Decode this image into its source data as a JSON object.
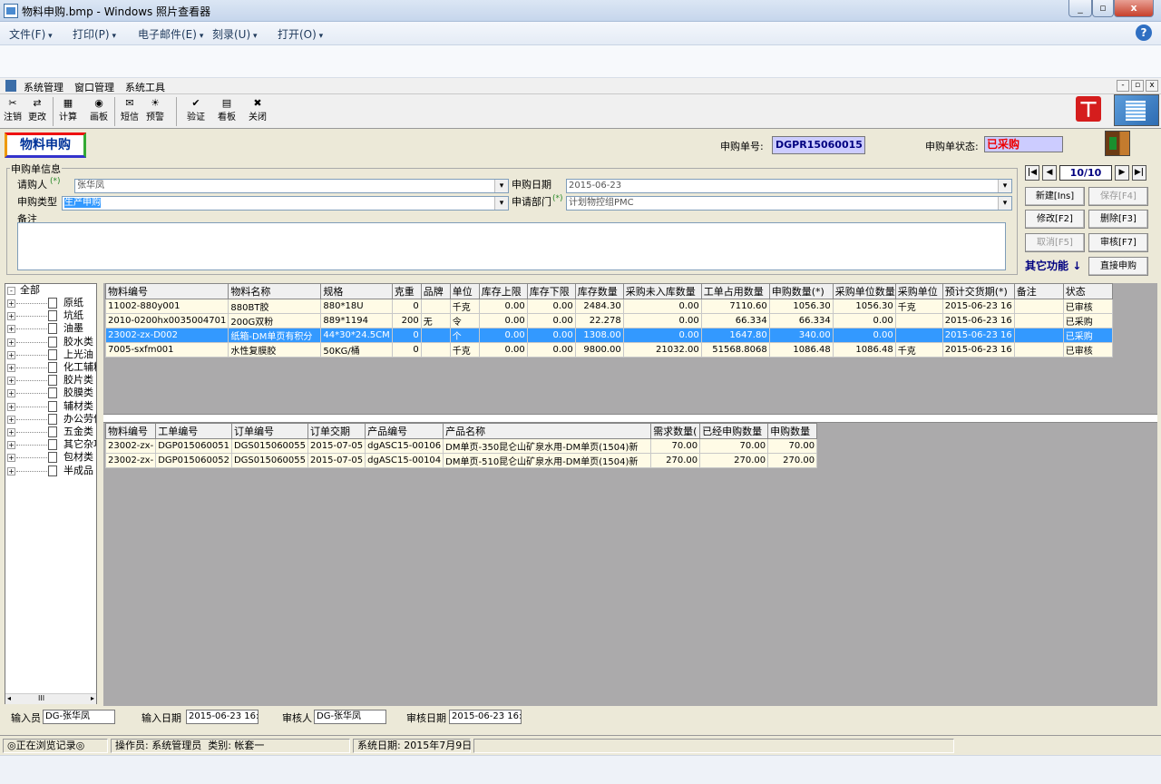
{
  "viewer": {
    "title": "物料申购.bmp - Windows 照片查看器",
    "menu": [
      "文件(F)",
      "打印(P)",
      "电子邮件(E)",
      "刻录(U)",
      "打开(O)"
    ],
    "help": "?"
  },
  "app": {
    "menu": [
      "系统管理",
      "窗口管理",
      "系统工具"
    ],
    "mdi": [
      "-",
      "▫",
      "x"
    ],
    "toolbar": [
      {
        "label": "注销",
        "icon": "logout-icon"
      },
      {
        "label": "更改",
        "icon": "change-icon"
      },
      {
        "label": "计算",
        "icon": "calculator-icon"
      },
      {
        "label": "画板",
        "icon": "palette-icon"
      },
      {
        "label": "短信",
        "icon": "sms-icon"
      },
      {
        "label": "预警",
        "icon": "alert-icon"
      },
      {
        "label": "验证",
        "icon": "verify-icon"
      },
      {
        "label": "看板",
        "icon": "board-icon"
      },
      {
        "label": "关闭",
        "icon": "close-icon"
      }
    ],
    "logo": "ㄒ"
  },
  "header": {
    "page_title": "物料申购",
    "order_no_label": "申购单号:",
    "order_no": "DGPR15060015",
    "status_label": "申购单状态:",
    "status": "已采购"
  },
  "form": {
    "group_label": "申购单信息",
    "requester_label": "请购人",
    "requester": "张华凤",
    "type_label": "申购类型",
    "type": "生产申购",
    "date_label": "申购日期",
    "date": "2015-06-23",
    "dept_label": "申请部门",
    "dept": "计划物控组PMC",
    "remark_label": "备注",
    "required_mark": "(*)"
  },
  "nav": {
    "first": "|◀",
    "prev": "◀",
    "counter": "10/10",
    "next": "▶",
    "last": "▶|"
  },
  "actions": {
    "new": "新建[Ins]",
    "save": "保存[F4]",
    "edit": "修改[F2]",
    "delete": "删除[F3]",
    "cancel": "取消[F5]",
    "approve": "审核[F7]",
    "other": "其它功能",
    "direct": "直接申购"
  },
  "tree": {
    "root": "全部",
    "items": [
      "原纸",
      "坑纸",
      "油墨",
      "胶水类",
      "上光油",
      "化工辅料",
      "胶片类",
      "胶膜类",
      "辅材类",
      "办公劳保",
      "五金类",
      "其它杂项",
      "包材类",
      "半成品"
    ],
    "scroll_mid": "III"
  },
  "grid1": {
    "columns": [
      "物料编号",
      "物料名称",
      "规格",
      "克重",
      "品牌",
      "单位",
      "库存上限",
      "库存下限",
      "库存数量",
      "采购未入库数量",
      "工单占用数量",
      "申购数量(*)",
      "采购单位数量",
      "采购单位",
      "预计交货期(*)",
      "备注",
      "状态"
    ],
    "rows": [
      [
        "11002-880y001",
        "880BT胶",
        "880*18U",
        "0",
        "",
        "千克",
        "0.00",
        "0.00",
        "2484.30",
        "0.00",
        "7110.60",
        "1056.30",
        "1056.30",
        "千克",
        "2015-06-23 16",
        "",
        "已审核"
      ],
      [
        "2010-0200hx0035004701",
        "200G双粉",
        "889*1194",
        "200",
        "无",
        "令",
        "0.00",
        "0.00",
        "22.278",
        "0.00",
        "66.334",
        "66.334",
        "0.00",
        "",
        "2015-06-23 16",
        "",
        "已采购"
      ],
      [
        "23002-zx-D002",
        "纸箱-DM单页有积分",
        "44*30*24.5CM",
        "0",
        "",
        "个",
        "0.00",
        "0.00",
        "1308.00",
        "0.00",
        "1647.80",
        "340.00",
        "0.00",
        "",
        "2015-06-23 16",
        "",
        "已采购"
      ],
      [
        "7005-sxfm001",
        "水性复膜胶",
        "50KG/桶",
        "0",
        "",
        "千克",
        "0.00",
        "0.00",
        "9800.00",
        "21032.00",
        "51568.8068",
        "1086.48",
        "1086.48",
        "千克",
        "2015-06-23 16",
        "",
        "已审核"
      ]
    ],
    "selected_row": 2
  },
  "grid2": {
    "columns": [
      "物料编号",
      "工单编号",
      "订单编号",
      "订单交期",
      "产品编号",
      "产品名称",
      "需求数量(",
      "已经申购数量",
      "申购数量"
    ],
    "rows": [
      [
        "23002-zx-",
        "DGP015060051",
        "DGS015060055",
        "2015-07-05",
        "dgASC15-00106",
        "DM单页-350昆仑山矿泉水用-DM单页(1504)新",
        "70.00",
        "70.00",
        "70.00"
      ],
      [
        "23002-zx-",
        "DGP015060052",
        "DGS015060055",
        "2015-07-05",
        "dgASC15-00104",
        "DM单页-510昆仑山矿泉水用-DM单页(1504)新",
        "270.00",
        "270.00",
        "270.00"
      ]
    ]
  },
  "footer": {
    "input_by_label": "输入员",
    "input_by": "DG-张华凤",
    "input_date_label": "输入日期",
    "input_date": "2015-06-23 16:",
    "auditor_label": "审核人",
    "auditor": "DG-张华凤",
    "audit_date_label": "审核日期",
    "audit_date": "2015-06-23 16:"
  },
  "status": {
    "browse": "◎正在浏览记录◎",
    "operator": "操作员: 系统管理员",
    "category": "类别: 帐套一",
    "sysdate": "系统日期: 2015年7月9日"
  }
}
